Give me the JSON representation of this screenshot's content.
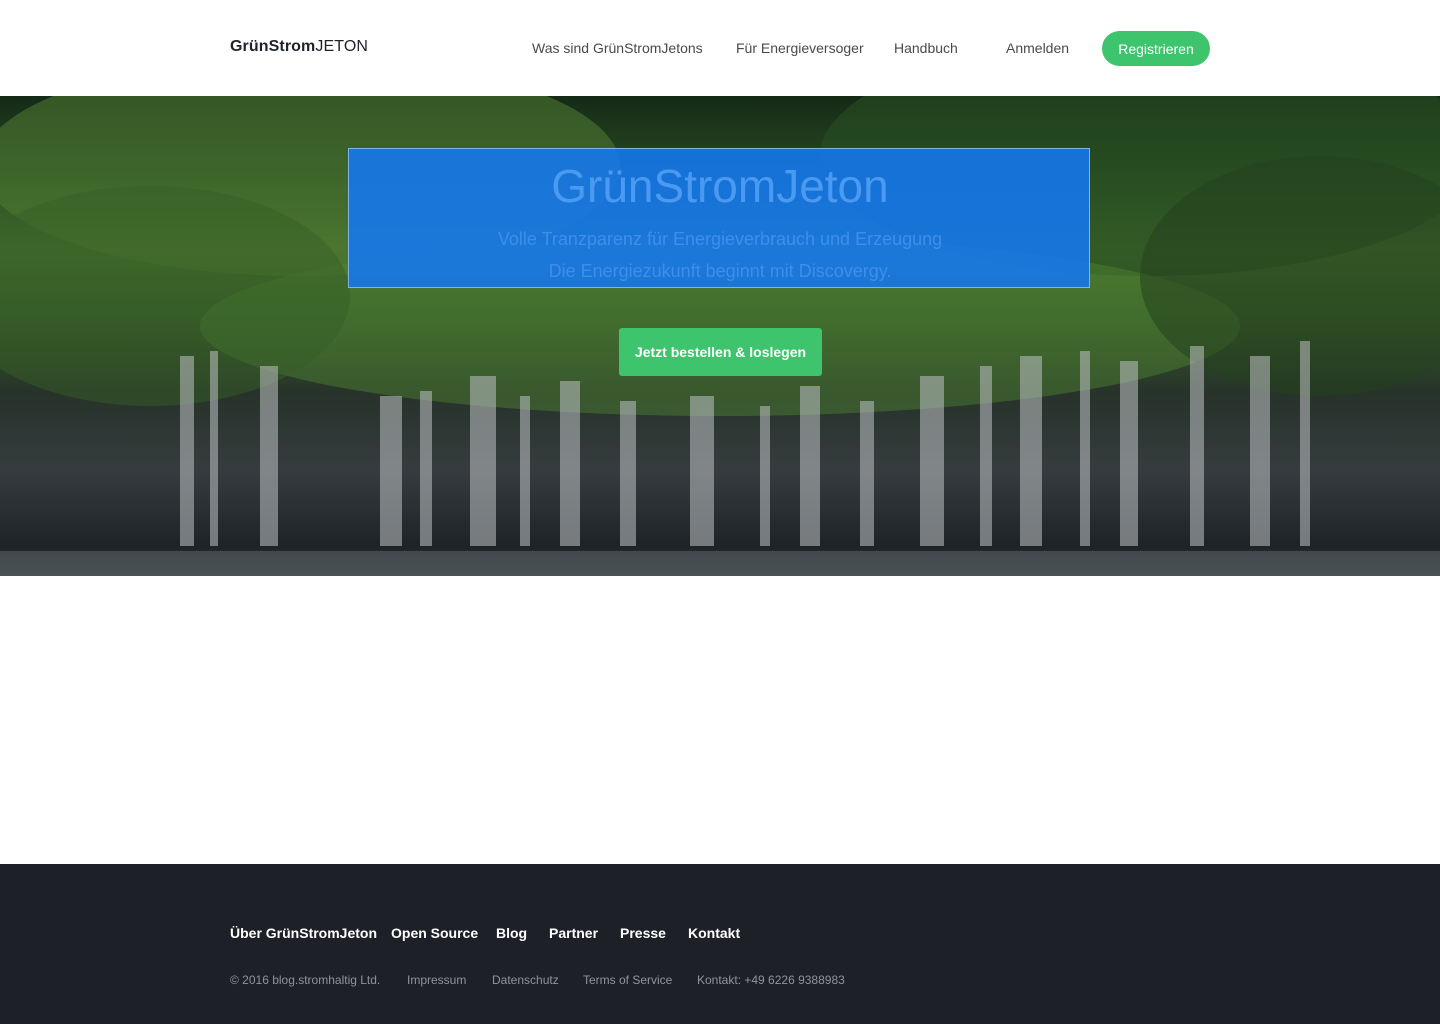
{
  "header": {
    "logo_bold": "GrünStrom",
    "logo_light": "JETON",
    "nav": [
      {
        "label": "Was sind GrünStromJetons"
      },
      {
        "label": "Für Energieversoger"
      },
      {
        "label": "Handbuch"
      },
      {
        "label": "Anmelden"
      }
    ],
    "register_label": "Registrieren"
  },
  "hero": {
    "title": "GrünStromJeton",
    "subtitle_line1": "Volle Tranzparenz für Energieverbrauch und Erzeugung",
    "subtitle_line2": "Die Energiezukunft beginnt mit Discovergy.",
    "cta_label": "Jetzt bestellen & loslegen"
  },
  "footer": {
    "links": [
      {
        "label": "Über GrünStromJeton"
      },
      {
        "label": "Open Source"
      },
      {
        "label": "Blog"
      },
      {
        "label": "Partner"
      },
      {
        "label": "Presse"
      },
      {
        "label": "Kontakt"
      }
    ],
    "copyright": "© 2016 blog.stromhaltig Ltd.",
    "meta_links": [
      {
        "label": "Impressum"
      },
      {
        "label": "Datenschutz"
      },
      {
        "label": "Terms of Service"
      },
      {
        "label": "Kontakt: +49 6226 9388983"
      }
    ]
  },
  "colors": {
    "accent": "#3ec46d",
    "overlay_blue": "#1478f0",
    "footer_bg": "#1e2028"
  }
}
